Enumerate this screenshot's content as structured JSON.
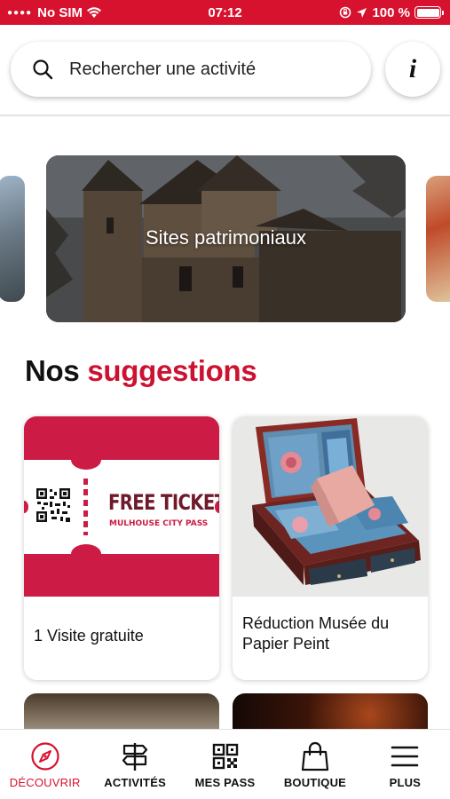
{
  "status_bar": {
    "carrier": "No SIM",
    "time": "07:12",
    "battery": "100 %"
  },
  "search": {
    "placeholder": "Rechercher une activité"
  },
  "info_button": {
    "label": "i"
  },
  "carousel": {
    "featured_title": "Sites patrimoniaux"
  },
  "suggestions": {
    "heading_plain": "Nos",
    "heading_accent": "suggestions",
    "cards": [
      {
        "label": "1 Visite gratuite",
        "ticket_main": "FREE TICKET",
        "ticket_sub": "MULHOUSE CITY PASS"
      },
      {
        "label": "Réduction Musée du Papier Peint"
      }
    ]
  },
  "tab_bar": {
    "tabs": [
      {
        "label": "DÉCOUVRIR",
        "icon": "compass-icon",
        "active": true
      },
      {
        "label": "ACTIVITÉS",
        "icon": "signpost-icon",
        "active": false
      },
      {
        "label": "MES PASS",
        "icon": "qr-code-icon",
        "active": false
      },
      {
        "label": "BOUTIQUE",
        "icon": "shopping-bag-icon",
        "active": false
      },
      {
        "label": "PLUS",
        "icon": "menu-icon",
        "active": false
      }
    ]
  },
  "colors": {
    "brand_red": "#d6122f",
    "ticket_red": "#cc1b45"
  }
}
